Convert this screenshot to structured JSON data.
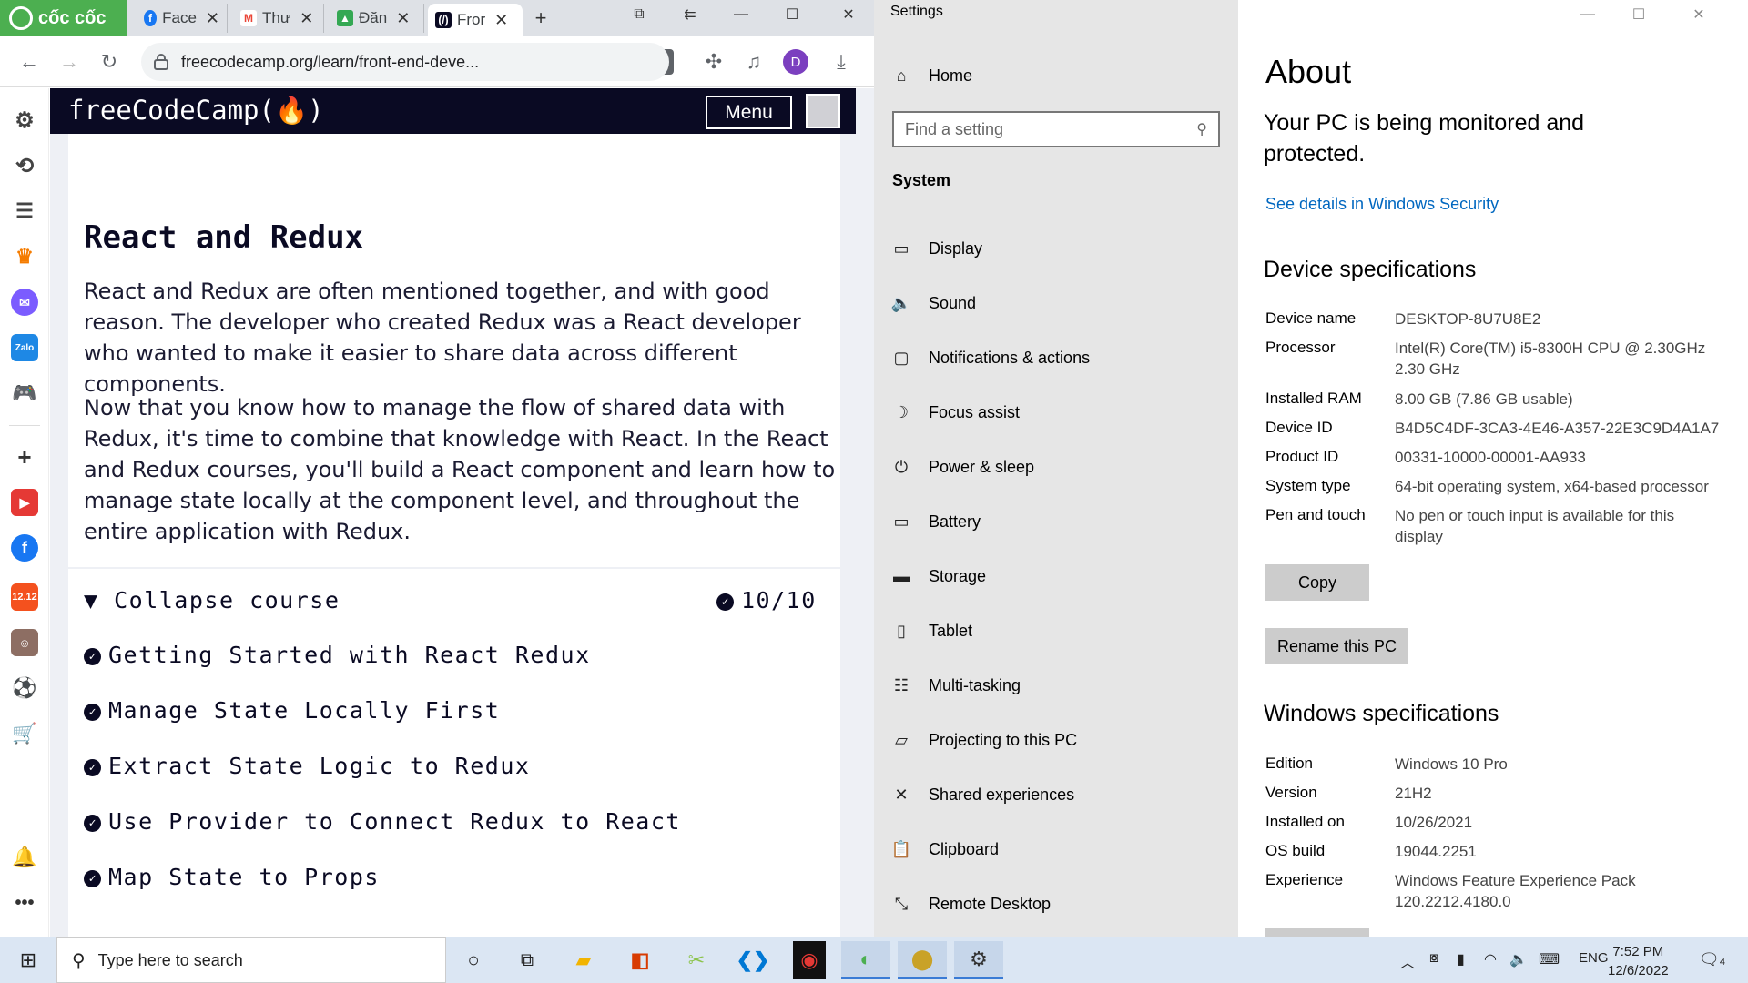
{
  "browser": {
    "brand": "cốc cốc",
    "tabs": [
      {
        "label": "Face",
        "icon": "facebook-icon",
        "color": "#1877f2"
      },
      {
        "label": "Thư",
        "icon": "gmail-icon",
        "color": "#ea4335"
      },
      {
        "label": "Đăn",
        "icon": "google-drive-icon",
        "color": "#34a853"
      },
      {
        "label": "Fror",
        "icon": "freecodecamp-icon",
        "color": "#0a0a23"
      }
    ],
    "url": "freecodecamp.org/learn/front-end-deve...",
    "profile_initial": "D",
    "accent": "#4caf50"
  },
  "fcc": {
    "logo": "freeCodeCamp(🔥)",
    "menu_label": "Menu",
    "title": "React and Redux",
    "para1": "React and Redux are often mentioned together, and with good reason. The developer who created Redux was a React developer who wanted to make it easier to share data across different components.",
    "para2": "Now that you know how to manage the flow of shared data with Redux, it's time to combine that knowledge with React. In the React and Redux courses, you'll build a React component and learn how to manage state locally at the component level, and throughout the entire application with Redux.",
    "collapse_label": "▼ Collapse course",
    "progress": "10/10",
    "lessons": [
      "Getting Started with React Redux",
      "Manage State Locally First",
      "Extract State Logic to Redux",
      "Use Provider to Connect Redux to React",
      "Map State to Props"
    ]
  },
  "settings": {
    "window_title": "Settings",
    "home": "Home",
    "search_placeholder": "Find a setting",
    "section": "System",
    "nav": [
      {
        "label": "Display",
        "icon": "display-icon"
      },
      {
        "label": "Sound",
        "icon": "sound-icon"
      },
      {
        "label": "Notifications & actions",
        "icon": "notifications-icon"
      },
      {
        "label": "Focus assist",
        "icon": "focus-assist-icon"
      },
      {
        "label": "Power & sleep",
        "icon": "power-icon"
      },
      {
        "label": "Battery",
        "icon": "battery-icon"
      },
      {
        "label": "Storage",
        "icon": "storage-icon"
      },
      {
        "label": "Tablet",
        "icon": "tablet-icon"
      },
      {
        "label": "Multi-tasking",
        "icon": "multitasking-icon"
      },
      {
        "label": "Projecting to this PC",
        "icon": "projecting-icon"
      },
      {
        "label": "Shared experiences",
        "icon": "shared-experiences-icon"
      },
      {
        "label": "Clipboard",
        "icon": "clipboard-icon"
      },
      {
        "label": "Remote Desktop",
        "icon": "remote-desktop-icon"
      }
    ],
    "about": {
      "title": "About",
      "monitored": "Your PC is being monitored and protected.",
      "security_link": "See details in Windows Security",
      "device_heading": "Device specifications",
      "device_specs": [
        {
          "label": "Device name",
          "value": "DESKTOP-8U7U8E2"
        },
        {
          "label": "Processor",
          "value": "Intel(R) Core(TM) i5-8300H CPU @ 2.30GHz 2.30 GHz"
        },
        {
          "label": "Installed RAM",
          "value": "8.00 GB (7.86 GB usable)"
        },
        {
          "label": "Device ID",
          "value": "B4D5C4DF-3CA3-4E46-A357-22E3C9D4A1A7"
        },
        {
          "label": "Product ID",
          "value": "00331-10000-00001-AA933"
        },
        {
          "label": "System type",
          "value": "64-bit operating system, x64-based processor"
        },
        {
          "label": "Pen and touch",
          "value": "No pen or touch input is available for this display"
        }
      ],
      "copy_label": "Copy",
      "rename_label": "Rename this PC",
      "windows_heading": "Windows specifications",
      "windows_specs": [
        {
          "label": "Edition",
          "value": "Windows 10 Pro"
        },
        {
          "label": "Version",
          "value": "21H2"
        },
        {
          "label": "Installed on",
          "value": "10/26/2021"
        },
        {
          "label": "OS build",
          "value": "19044.2251"
        },
        {
          "label": "Experience",
          "value": "Windows Feature Experience Pack 120.2212.4180.0"
        }
      ]
    }
  },
  "taskbar": {
    "search_placeholder": "Type here to search",
    "language": "ENG",
    "time": "7:52 PM",
    "date": "12/6/2022",
    "notification_count": "4"
  }
}
